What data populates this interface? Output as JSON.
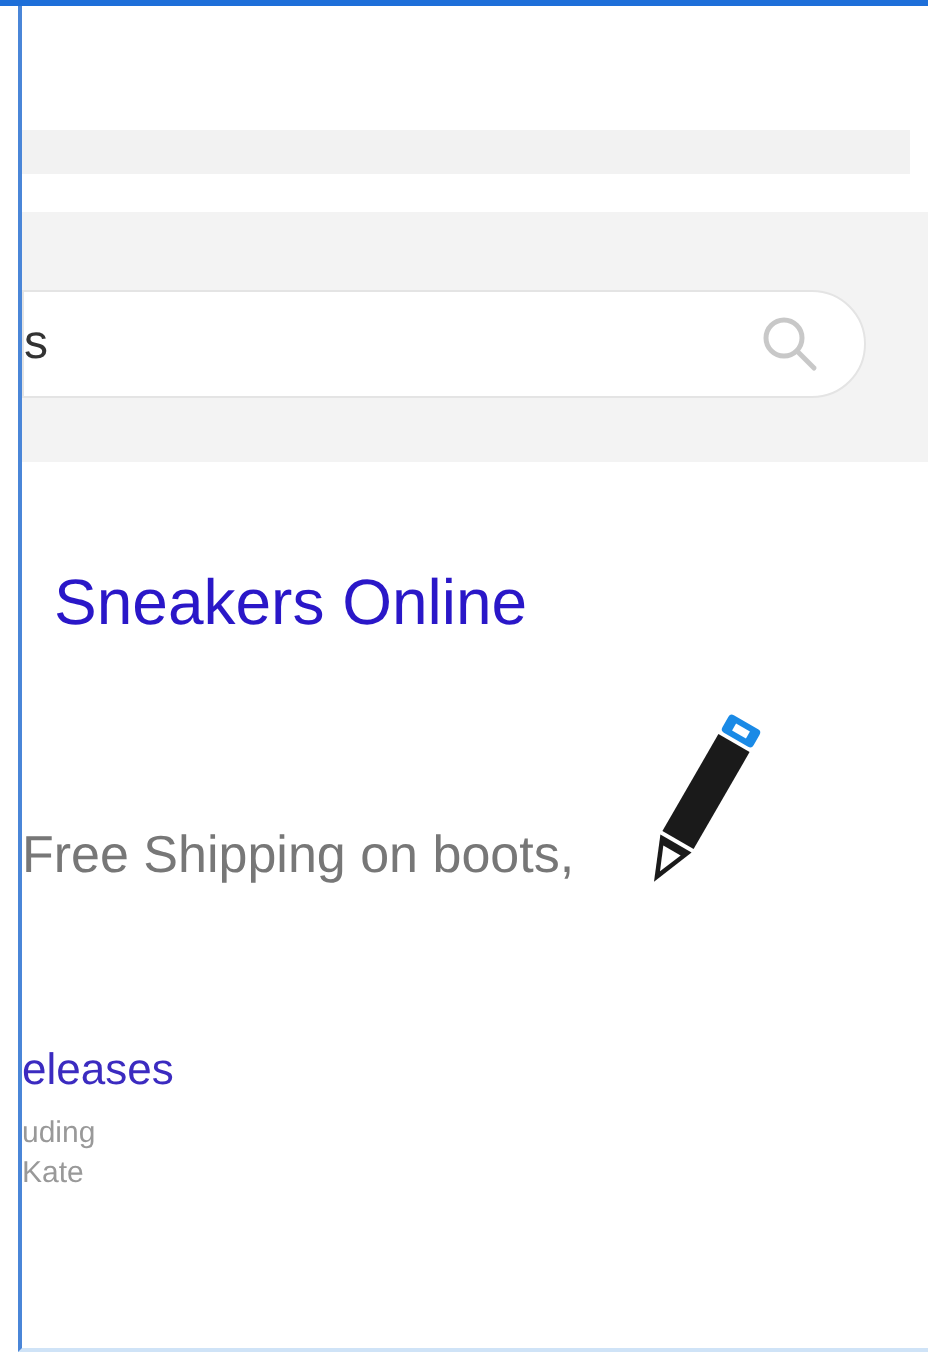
{
  "search": {
    "value": "s"
  },
  "result": {
    "title": "Sneakers Online",
    "snippet": "Free Shipping on boots,"
  },
  "sublink": {
    "title": "eleases",
    "lines": [
      "uding",
      "Kate"
    ]
  }
}
